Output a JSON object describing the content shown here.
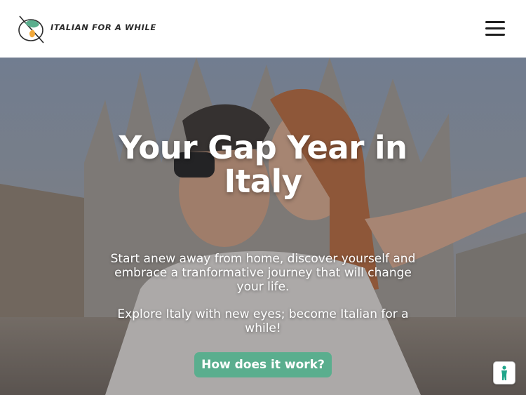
{
  "header": {
    "logo_text": "ITALIAN FOR A WHILE",
    "menu_icon": "hamburger-menu-icon"
  },
  "hero": {
    "title_line1": "Your Gap Year in",
    "title_line2": "Italy",
    "paragraph1": "Start anew away from home, discover yourself and embrace a tranformative journey that will change your life.",
    "paragraph2": "Explore Italy with new eyes; become Italian for a while!",
    "cta_label": "How does it work?"
  },
  "accessibility_widget": {
    "icon": "accessibility-person-icon"
  },
  "colors": {
    "cta": "#5aae8e",
    "header_bg": "#ffffff",
    "logo_green": "#5aae8e",
    "logo_orange": "#f2a93b"
  }
}
